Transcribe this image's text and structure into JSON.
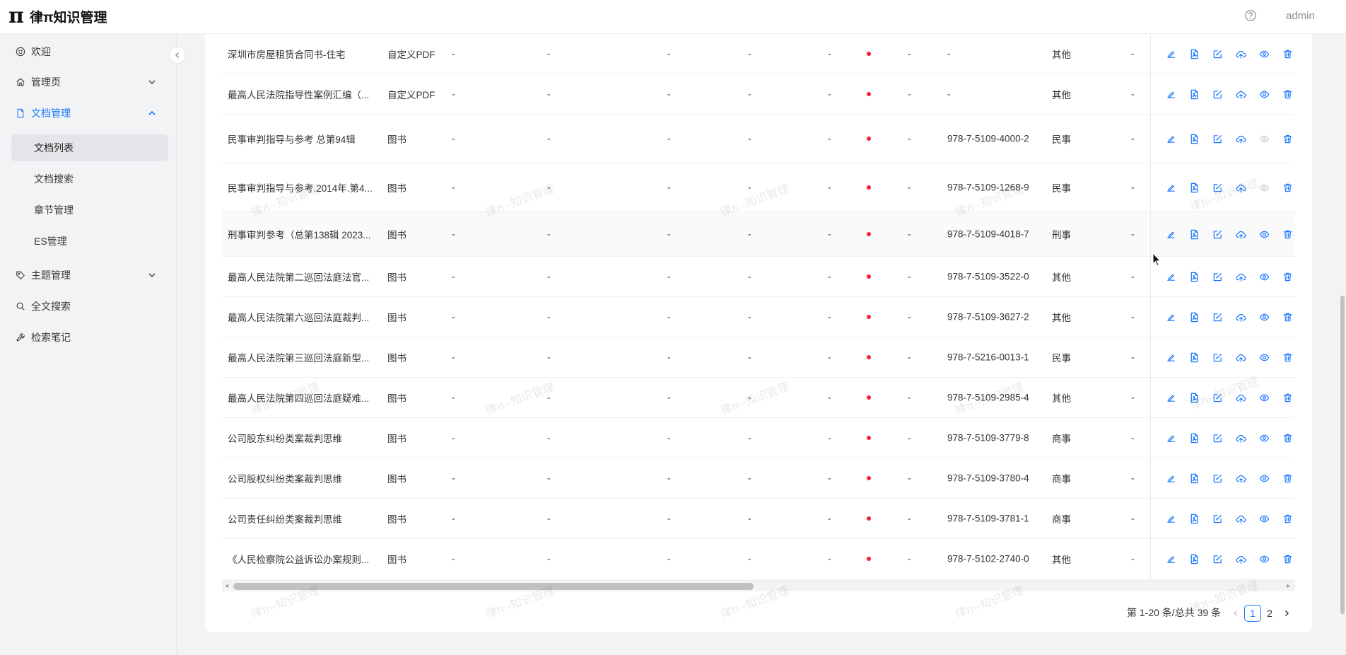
{
  "header": {
    "logo_mark": "π",
    "app_title": "律π知识管理",
    "user": "admin"
  },
  "sidebar": {
    "items": [
      {
        "label": "欢迎",
        "icon": "smile-icon"
      },
      {
        "label": "管理页",
        "icon": "home-icon",
        "arrow": "chevron-down-icon"
      },
      {
        "label": "文档管理",
        "icon": "file-icon",
        "arrow": "chevron-up-icon",
        "active": true
      },
      {
        "label": "主题管理",
        "icon": "tag-icon",
        "arrow": "chevron-down-icon"
      },
      {
        "label": "全文搜索",
        "icon": "search-icon"
      },
      {
        "label": "检索笔记",
        "icon": "tool-icon"
      }
    ],
    "sub_items": [
      {
        "label": "文档列表",
        "active": true
      },
      {
        "label": "文档搜索"
      },
      {
        "label": "章节管理"
      },
      {
        "label": "ES管理"
      }
    ]
  },
  "table": {
    "rows": [
      {
        "name": "深圳市房屋租赁合同书-住宅",
        "type": "自定义PDF",
        "c1": "-",
        "c2": "-",
        "c3": "-",
        "c4": "-",
        "c5": "-",
        "c6": "-",
        "isbn": "-",
        "category": "其他",
        "c7": "-",
        "preview_disabled": false
      },
      {
        "name": "最高人民法院指导性案例汇编（...",
        "type": "自定义PDF",
        "c1": "-",
        "c2": "-",
        "c3": "-",
        "c4": "-",
        "c5": "-",
        "c6": "-",
        "isbn": "-",
        "category": "其他",
        "c7": "-",
        "preview_disabled": false
      },
      {
        "name": "民事审判指导与参考 总第94辑",
        "type": "图书",
        "c1": "-",
        "c2": "-",
        "c3": "-",
        "c4": "-",
        "c5": "-",
        "c6": "-",
        "isbn": "978-7-5109-4000-2",
        "category": "民事",
        "c7": "-",
        "preview_disabled": true
      },
      {
        "name": "民事审判指导与参考.2014年.第4...",
        "type": "图书",
        "c1": "-",
        "c2": "-",
        "c3": "-",
        "c4": "-",
        "c5": "-",
        "c6": "-",
        "isbn": "978-7-5109-1268-9",
        "category": "民事",
        "c7": "-",
        "preview_disabled": true
      },
      {
        "name": "刑事审判参考（总第138辑 2023...",
        "type": "图书",
        "c1": "-",
        "c2": "-",
        "c3": "-",
        "c4": "-",
        "c5": "-",
        "c6": "-",
        "isbn": "978-7-5109-4018-7",
        "category": "刑事",
        "c7": "-",
        "preview_disabled": false
      },
      {
        "name": "最高人民法院第二巡回法庭法官...",
        "type": "图书",
        "c1": "-",
        "c2": "-",
        "c3": "-",
        "c4": "-",
        "c5": "-",
        "c6": "-",
        "isbn": "978-7-5109-3522-0",
        "category": "其他",
        "c7": "-",
        "preview_disabled": false
      },
      {
        "name": "最高人民法院第六巡回法庭裁判...",
        "type": "图书",
        "c1": "-",
        "c2": "-",
        "c3": "-",
        "c4": "-",
        "c5": "-",
        "c6": "-",
        "isbn": "978-7-5109-3627-2",
        "category": "其他",
        "c7": "-",
        "preview_disabled": false
      },
      {
        "name": "最高人民法院第三巡回法庭新型...",
        "type": "图书",
        "c1": "-",
        "c2": "-",
        "c3": "-",
        "c4": "-",
        "c5": "-",
        "c6": "-",
        "isbn": "978-7-5216-0013-1",
        "category": "民事",
        "c7": "-",
        "preview_disabled": false
      },
      {
        "name": "最高人民法院第四巡回法庭疑难...",
        "type": "图书",
        "c1": "-",
        "c2": "-",
        "c3": "-",
        "c4": "-",
        "c5": "-",
        "c6": "-",
        "isbn": "978-7-5109-2985-4",
        "category": "其他",
        "c7": "-",
        "preview_disabled": false
      },
      {
        "name": "公司股东纠纷类案裁判思维",
        "type": "图书",
        "c1": "-",
        "c2": "-",
        "c3": "-",
        "c4": "-",
        "c5": "-",
        "c6": "-",
        "isbn": "978-7-5109-3779-8",
        "category": "商事",
        "c7": "-",
        "preview_disabled": false
      },
      {
        "name": "公司股权纠纷类案裁判思维",
        "type": "图书",
        "c1": "-",
        "c2": "-",
        "c3": "-",
        "c4": "-",
        "c5": "-",
        "c6": "-",
        "isbn": "978-7-5109-3780-4",
        "category": "商事",
        "c7": "-",
        "preview_disabled": false
      },
      {
        "name": "公司责任纠纷类案裁判思维",
        "type": "图书",
        "c1": "-",
        "c2": "-",
        "c3": "-",
        "c4": "-",
        "c5": "-",
        "c6": "-",
        "isbn": "978-7-5109-3781-1",
        "category": "商事",
        "c7": "-",
        "preview_disabled": false
      },
      {
        "name": "《人民检察院公益诉讼办案规则...",
        "type": "图书",
        "c1": "-",
        "c2": "-",
        "c3": "-",
        "c4": "-",
        "c5": "-",
        "c6": "-",
        "isbn": "978-7-5102-2740-0",
        "category": "其他",
        "c7": "-",
        "preview_disabled": false
      }
    ],
    "action_icons": [
      "edit-icon",
      "pdf-file-icon",
      "edit-square-icon",
      "cloud-upload-icon",
      "eye-icon",
      "delete-icon"
    ]
  },
  "pagination": {
    "summary": "第 1-20 条/总共 39 条",
    "pages": [
      "1",
      "2"
    ],
    "current": "1"
  },
  "watermark": "律π--知识管理",
  "colors": {
    "accent": "#1677ff",
    "status_dot": "#f5222d"
  }
}
